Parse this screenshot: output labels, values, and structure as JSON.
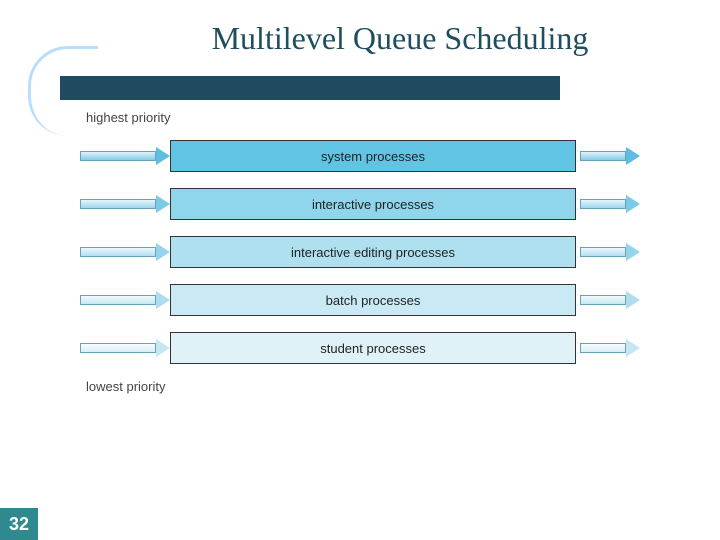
{
  "title": "Multilevel Queue Scheduling",
  "page_number": "32",
  "labels": {
    "highest": "highest priority",
    "lowest": "lowest priority"
  },
  "queues": [
    {
      "label": "system processes"
    },
    {
      "label": "interactive processes"
    },
    {
      "label": "interactive editing processes"
    },
    {
      "label": "batch processes"
    },
    {
      "label": "student processes"
    }
  ]
}
